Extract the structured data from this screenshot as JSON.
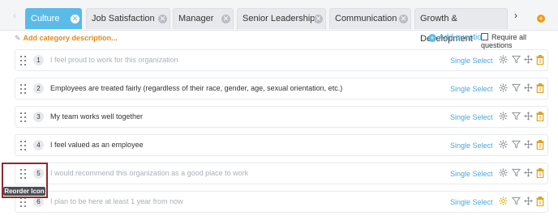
{
  "tabs": [
    {
      "label": "Culture",
      "active": true
    },
    {
      "label": "Job Satisfaction",
      "active": false
    },
    {
      "label": "Manager",
      "active": false
    },
    {
      "label": "Senior Leadership",
      "active": false
    },
    {
      "label": "Communication",
      "active": false
    },
    {
      "label": "Growth & Development",
      "active": false
    }
  ],
  "nav": {
    "left_glyph": "‹",
    "right_glyph": "›",
    "add_glyph": "+"
  },
  "toolbar": {
    "add_description": "Add category description...",
    "add_question": "Add question",
    "require_all": "Require all questions"
  },
  "questions": [
    {
      "number": "1",
      "text": "I feel proud to work for this organization",
      "type": "Single Select",
      "muted": true
    },
    {
      "number": "2",
      "text": "Employees are treated fairly (regardless of their race, gender, age, sexual orientation, etc.)",
      "type": "Single Select",
      "muted": false
    },
    {
      "number": "3",
      "text": "My team works well together",
      "type": "Single Select",
      "muted": false
    },
    {
      "number": "4",
      "text": "I feel valued as an employee",
      "type": "Single Select",
      "muted": false
    },
    {
      "number": "5",
      "text": "I would recommend this organization as a good place to work",
      "type": "Single Select",
      "muted": true
    },
    {
      "number": "6",
      "text": "I plan to be here at least 1 year from now",
      "type": "Single Select",
      "muted": true
    }
  ],
  "tooltip": {
    "text": "Reorder Icon"
  },
  "colors": {
    "accent": "#5bbbe8",
    "orange": "#f39c12",
    "trash": "#e0a21a",
    "highlight_border": "#8b2a2a"
  }
}
